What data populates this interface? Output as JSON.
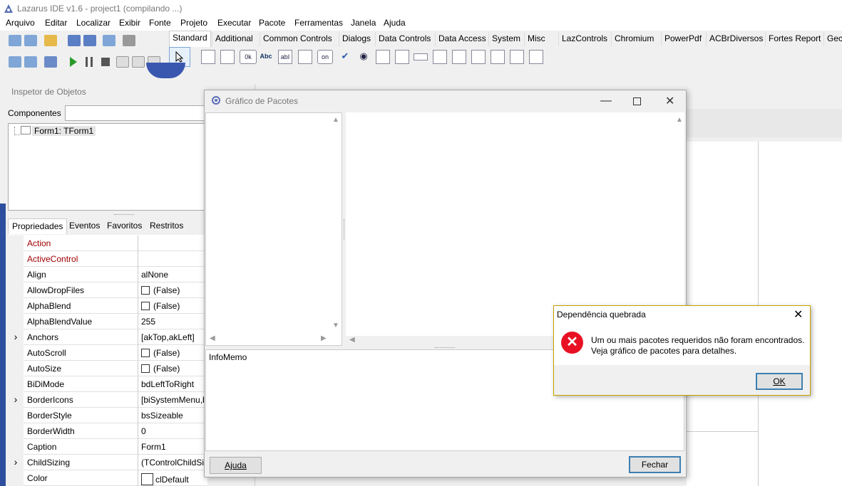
{
  "title": "Lazarus IDE v1.6 - project1 (compilando ...)",
  "menu": [
    "Arquivo",
    "Editar",
    "Localizar",
    "Exibir",
    "Fonte",
    "Projeto",
    "Executar",
    "Pacote",
    "Ferramentas",
    "Janela",
    "Ajuda"
  ],
  "palette_tabs": [
    "Standard",
    "Additional",
    "Common Controls",
    "Dialogs",
    "Data Controls",
    "Data Access",
    "System",
    "Misc",
    "LazControls",
    "Chromium",
    "PowerPdf",
    "ACBrDiversos",
    "Fortes Report",
    "Gec"
  ],
  "palette_icon_text": {
    "button": "0k",
    "label": "Abc",
    "edit": "abI",
    "toggle": "on"
  },
  "inspector": {
    "title": "Inspetor de Objetos",
    "components_label": "Componentes",
    "tree_item": "Form1: TForm1",
    "tabs": [
      "Propriedades",
      "Eventos",
      "Favoritos",
      "Restritos"
    ],
    "rows": [
      {
        "name": "Action",
        "value": "",
        "red": true
      },
      {
        "name": "ActiveControl",
        "value": "",
        "red": true
      },
      {
        "name": "Align",
        "value": "alNone"
      },
      {
        "name": "AllowDropFiles",
        "value": "(False)",
        "check": true
      },
      {
        "name": "AlphaBlend",
        "value": "(False)",
        "check": true
      },
      {
        "name": "AlphaBlendValue",
        "value": "255"
      },
      {
        "name": "Anchors",
        "value": "[akTop,akLeft]",
        "expand": true
      },
      {
        "name": "AutoScroll",
        "value": "(False)",
        "check": true
      },
      {
        "name": "AutoSize",
        "value": "(False)",
        "check": true
      },
      {
        "name": "BiDiMode",
        "value": "bdLeftToRight"
      },
      {
        "name": "BorderIcons",
        "value": "[biSystemMenu,b",
        "expand": true
      },
      {
        "name": "BorderStyle",
        "value": "bsSizeable"
      },
      {
        "name": "BorderWidth",
        "value": "0"
      },
      {
        "name": "Caption",
        "value": "Form1"
      },
      {
        "name": "ChildSizing",
        "value": "(TControlChildSi",
        "expand": true
      },
      {
        "name": "Color",
        "value": "clDefault",
        "swatch": true
      }
    ]
  },
  "pkg_window": {
    "title": "Gráfico de Pacotes",
    "infomemo": "InfoMemo",
    "help_button": "Ajuda",
    "close_button": "Fechar"
  },
  "error_dialog": {
    "title": "Dependência quebrada",
    "message_line1": "Um ou mais pacotes requeridos não foram encontrados.",
    "message_line2": "Veja gráfico de pacotes para detalhes.",
    "ok_button": "OK"
  },
  "colors": {
    "accent": "#3c7fb1",
    "error": "#e81123",
    "prop_red": "#a00000"
  }
}
